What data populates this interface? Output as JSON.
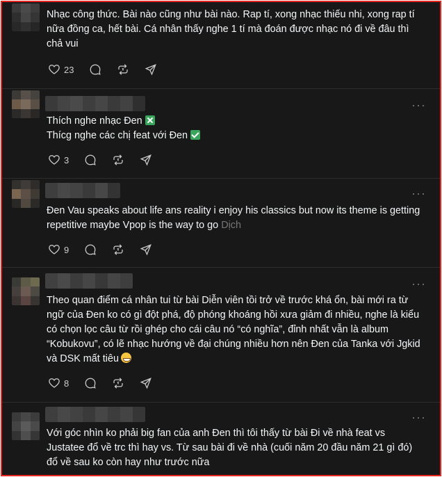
{
  "posts": [
    {
      "text": "Nhạc công thức. Bài nào cũng như bài nào. Rap tí, xong nhạc thiếu nhi, xong rap tí nữa đồng ca, hết bài. Cá nhân thấy nghe 1 tí mà đoán được nhạc nó đi về đâu thì chả vui",
      "likes": "23"
    },
    {
      "line1": "Thích nghe nhạc Đen",
      "line2": "Thícg nghe các chị feat với Đen",
      "likes": "3"
    },
    {
      "text": "Đen Vau speaks about life ans reality i enjoy his classics but now its theme is getting repetitive maybe Vpop is the way to go",
      "translate": "Dịch",
      "likes": "9"
    },
    {
      "text": "Theo quan điểm cá nhân tui từ bài Diễn viên tồi trở về trước khá ổn, bài mới ra từ ngữ của Đen ko có gì đột phá, độ phóng khoáng hồi xưa giảm đi nhiều, nghe là kiểu có chọn lọc câu từ rồi ghép cho cái câu nó “có nghĩa”, đỉnh nhất vẫn là album “Kobukovu”, có lẽ nhạc hướng về đại chúng nhiều hơn nên Đen của Tanka với Jgkid và DSK mất tiêu",
      "likes": "8"
    },
    {
      "text": "Với góc nhìn ko phải big fan của anh Đen thì tôi thấy từ bài Đi về nhà feat vs Justatee đổ về trc thì hay vs. Từ sau bài đi về nhà (cuối năm 20 đầu năm 21 gì đó) đổ về sau ko còn hay như trước nữa"
    }
  ],
  "more_label": "···",
  "icons": [
    "heart-icon",
    "comment-icon",
    "repost-icon",
    "share-icon",
    "more-icon"
  ]
}
